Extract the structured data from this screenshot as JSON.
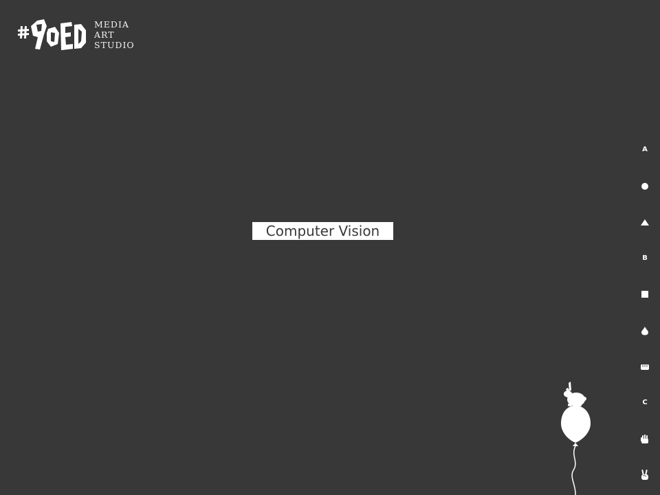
{
  "brand": {
    "logo_text": "#90ED",
    "tagline": [
      "MEDIA",
      "ART",
      "STUDIO"
    ]
  },
  "main": {
    "title": "Computer Vision"
  },
  "side_nav": {
    "items": [
      {
        "icon": "letter-a-icon",
        "letter": "A"
      },
      {
        "icon": "circle-icon"
      },
      {
        "icon": "triangle-icon"
      },
      {
        "icon": "letter-b-icon",
        "letter": "B"
      },
      {
        "icon": "square-icon"
      },
      {
        "icon": "drop-icon"
      },
      {
        "icon": "fist-icon"
      },
      {
        "icon": "letter-c-icon",
        "letter": "C"
      },
      {
        "icon": "open-hand-icon"
      },
      {
        "icon": "peace-hand-icon"
      }
    ]
  },
  "colors": {
    "background": "#383838",
    "foreground": "#ffffff"
  }
}
